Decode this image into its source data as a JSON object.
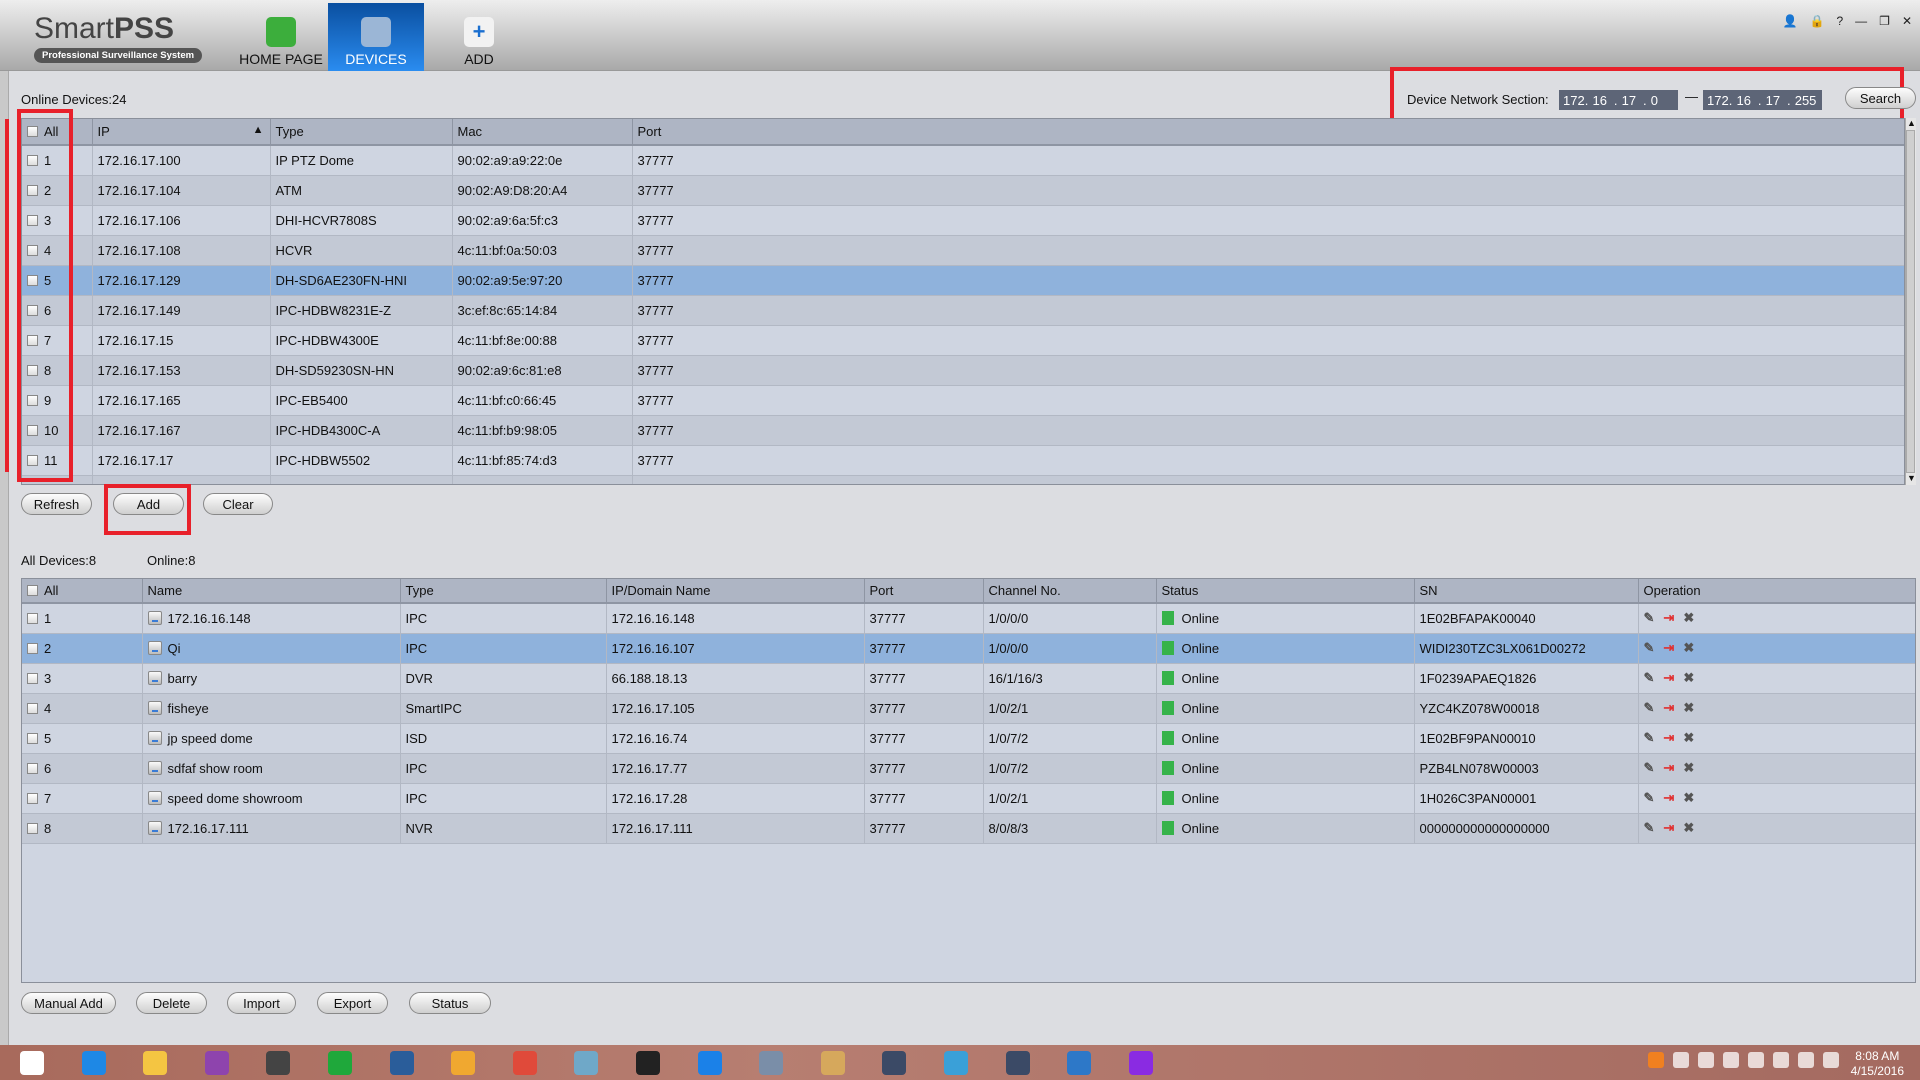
{
  "app": {
    "logo_main": "Smart",
    "logo_bold": "PSS",
    "logo_sub": "Professional Surveillance System"
  },
  "nav": [
    {
      "label": "HOME PAGE",
      "icon": "home-icon",
      "color": "#3cae3c"
    },
    {
      "label": "DEVICES",
      "icon": "camera-dome-icon",
      "color": "#9bb6d6",
      "active": true
    },
    {
      "label": "ADD",
      "icon": "plus-icon",
      "color": "#f2f2f2"
    }
  ],
  "window_controls": [
    "user-icon",
    "lock-icon",
    "help-icon",
    "minimize-icon",
    "restore-icon",
    "close-icon"
  ],
  "search_panel": {
    "online_devices": "Online Devices:24",
    "network_label": "Device Network Section:",
    "ip_start": [
      "172",
      "16",
      "17",
      "0"
    ],
    "ip_end": [
      "172",
      "16",
      "17",
      "255"
    ],
    "dash": "—",
    "search_button": "Search"
  },
  "online_table": {
    "columns": [
      "All",
      "IP",
      "Type",
      "Mac",
      "Port"
    ],
    "selected_row": 5,
    "rows": [
      [
        "1",
        "172.16.17.100",
        "IP PTZ Dome",
        "90:02:a9:a9:22:0e",
        "37777"
      ],
      [
        "2",
        "172.16.17.104",
        "ATM",
        "90:02:A9:D8:20:A4",
        "37777"
      ],
      [
        "3",
        "172.16.17.106",
        "DHI-HCVR7808S",
        "90:02:a9:6a:5f:c3",
        "37777"
      ],
      [
        "4",
        "172.16.17.108",
        "HCVR",
        "4c:11:bf:0a:50:03",
        "37777"
      ],
      [
        "5",
        "172.16.17.129",
        "DH-SD6AE230FN-HNI",
        "90:02:a9:5e:97:20",
        "37777"
      ],
      [
        "6",
        "172.16.17.149",
        "IPC-HDBW8231E-Z",
        "3c:ef:8c:65:14:84",
        "37777"
      ],
      [
        "7",
        "172.16.17.15",
        "IPC-HDBW4300E",
        "4c:11:bf:8e:00:88",
        "37777"
      ],
      [
        "8",
        "172.16.17.153",
        "DH-SD59230SN-HN",
        "90:02:a9:6c:81:e8",
        "37777"
      ],
      [
        "9",
        "172.16.17.165",
        "IPC-EB5400",
        "4c:11:bf:c0:66:45",
        "37777"
      ],
      [
        "10",
        "172.16.17.167",
        "IPC-HDB4300C-A",
        "4c:11:bf:b9:98:05",
        "37777"
      ],
      [
        "11",
        "172.16.17.17",
        "IPC-HDBW5502",
        "4c:11:bf:85:74:d3",
        "37777"
      ]
    ],
    "buttons": [
      "Refresh",
      "Add",
      "Clear"
    ]
  },
  "added_devices": {
    "all_count": "All Devices:8",
    "online_count": "Online:8",
    "columns": [
      "All",
      "Name",
      "Type",
      "IP/Domain Name",
      "Port",
      "Channel No.",
      "Status",
      "SN",
      "Operation"
    ],
    "selected_row": 2,
    "status_color": "#36b34a",
    "rows": [
      [
        "1",
        "172.16.16.148",
        "IPC",
        "172.16.16.148",
        "37777",
        "1/0/0/0",
        "Online",
        "1E02BFAPAK00040"
      ],
      [
        "2",
        "Qi",
        "IPC",
        "172.16.16.107",
        "37777",
        "1/0/0/0",
        "Online",
        "WIDI230TZC3LX061D00272"
      ],
      [
        "3",
        "barry",
        "DVR",
        "66.188.18.13",
        "37777",
        "16/1/16/3",
        "Online",
        "1F0239APAEQ1826"
      ],
      [
        "4",
        "fisheye",
        "SmartIPC",
        "172.16.17.105",
        "37777",
        "1/0/2/1",
        "Online",
        "YZC4KZ078W00018"
      ],
      [
        "5",
        "jp speed dome",
        "ISD",
        "172.16.16.74",
        "37777",
        "1/0/7/2",
        "Online",
        "1E02BF9PAN00010"
      ],
      [
        "6",
        "sdfaf show room",
        "IPC",
        "172.16.17.77",
        "37777",
        "1/0/7/2",
        "Online",
        "PZB4LN078W00003"
      ],
      [
        "7",
        "speed dome showroom",
        "IPC",
        "172.16.17.28",
        "37777",
        "1/0/2/1",
        "Online",
        "1H026C3PAN00001"
      ],
      [
        "8",
        "172.16.17.111",
        "NVR",
        "172.16.17.111",
        "37777",
        "8/0/8/3",
        "Online",
        "000000000000000000"
      ]
    ],
    "operations": [
      "edit-icon",
      "logout-icon",
      "delete-icon"
    ],
    "buttons": [
      "Manual Add",
      "Delete",
      "Import",
      "Export",
      "Status"
    ]
  },
  "taskbar": {
    "apps": [
      {
        "icon": "windows-start-icon",
        "color": "#ffffff"
      },
      {
        "icon": "internet-explorer-icon",
        "color": "#1e88e5"
      },
      {
        "icon": "file-explorer-icon",
        "color": "#f4c542"
      },
      {
        "icon": "photo-app-icon",
        "color": "#8e44ad"
      },
      {
        "icon": "smartpss-icon",
        "color": "#444444"
      },
      {
        "icon": "store-icon",
        "color": "#1fa83b"
      },
      {
        "icon": "chat-icon",
        "color": "#2a5d9a"
      },
      {
        "icon": "mail-icon",
        "color": "#f0a830"
      },
      {
        "icon": "chrome-icon",
        "color": "#e04a3a"
      },
      {
        "icon": "notes-icon",
        "color": "#6fa8c8"
      },
      {
        "icon": "qq-icon",
        "color": "#222222"
      },
      {
        "icon": "dropbox-icon",
        "color": "#1b81e8"
      },
      {
        "icon": "webcam-icon",
        "color": "#7a8ea8"
      },
      {
        "icon": "paint-icon",
        "color": "#d6a85c"
      },
      {
        "icon": "camera-app-icon",
        "color": "#3b4a66"
      },
      {
        "icon": "network-tool-icon",
        "color": "#3aa0d8"
      },
      {
        "icon": "camera-app-2-icon",
        "color": "#3b4a66"
      },
      {
        "icon": "search-tool-icon",
        "color": "#2d78c8"
      },
      {
        "icon": "magnifier-icon",
        "color": "#8a2be2"
      }
    ],
    "tray": [
      "alert-icon",
      "show-hidden-icon",
      "qq-tray-icon",
      "action-center-icon",
      "dropbox-tray-icon",
      "signal-icon",
      "windows-icon",
      "volume-icon"
    ],
    "time": "8:08 AM",
    "date": "4/15/2016"
  },
  "colors": {
    "accent": "#1f6fd0",
    "highlight": "#e8202a",
    "selected_row": "#8fb2dc"
  }
}
